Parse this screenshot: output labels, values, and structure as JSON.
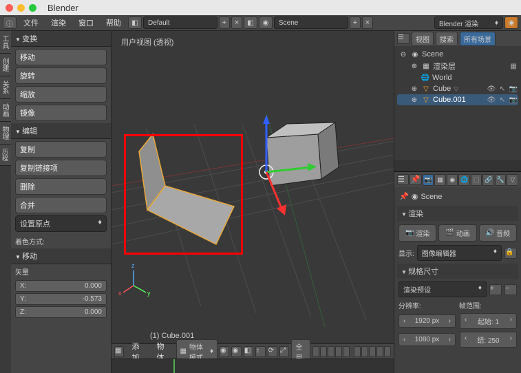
{
  "app": {
    "title": "Blender"
  },
  "menubar": {
    "file": "文件",
    "render": "渲染",
    "window": "窗口",
    "help": "帮助",
    "layout": "Default",
    "scene": "Scene",
    "engine": "Blender 渲染"
  },
  "left_tabs": [
    "工具",
    "创建",
    "关系",
    "动画",
    "物理",
    "历程"
  ],
  "tool": {
    "transform_header": "变换",
    "translate": "移动",
    "rotate": "旋转",
    "scale": "缩放",
    "mirror": "镜像",
    "edit_header": "编辑",
    "duplicate": "复制",
    "duplicate_linked": "复制链接项",
    "delete": "删除",
    "join": "合并",
    "set_origin": "设置原点",
    "shade": "着色方式:",
    "last_op_header": "移动",
    "vector": "矢量",
    "x_label": "X:",
    "x_val": "0.000",
    "y_label": "Y:",
    "y_val": "-0.573",
    "z_label": "Z:",
    "z_val": "0.000"
  },
  "viewport": {
    "region": "用户视图  (透视)",
    "object_label": "(1) Cube.001",
    "menu_add": "添加",
    "menu_object": "物体",
    "mode": "物体模式",
    "orientation": "全局"
  },
  "outliner": {
    "view": "视图",
    "search": "搜索",
    "all_scenes": "所有场景",
    "scene": "Scene",
    "render_layers": "渲染层",
    "world": "World",
    "cube": "Cube",
    "cube001": "Cube.001"
  },
  "props": {
    "scene_crumb": "Scene",
    "render_header": "渲染",
    "render_btn": "渲染",
    "anim_btn": "动画",
    "audio_btn": "音频",
    "display_label": "显示:",
    "display_value": "图像编辑器",
    "dimensions_header": "规格尺寸",
    "render_preset": "渲染预设",
    "res_label": "分辨率:",
    "frame_range_label": "帧范围:",
    "res_x": "1920 px",
    "res_y": "1080 px",
    "frame_start_label": "起始:",
    "frame_start": "1",
    "frame_end_label": "结:",
    "frame_end": "250"
  },
  "colors": {
    "accent": "#3a6a9a",
    "highlight": "#ff0000",
    "axis_x": "#ff3030",
    "axis_y": "#30ff30",
    "axis_z": "#3060ff"
  }
}
